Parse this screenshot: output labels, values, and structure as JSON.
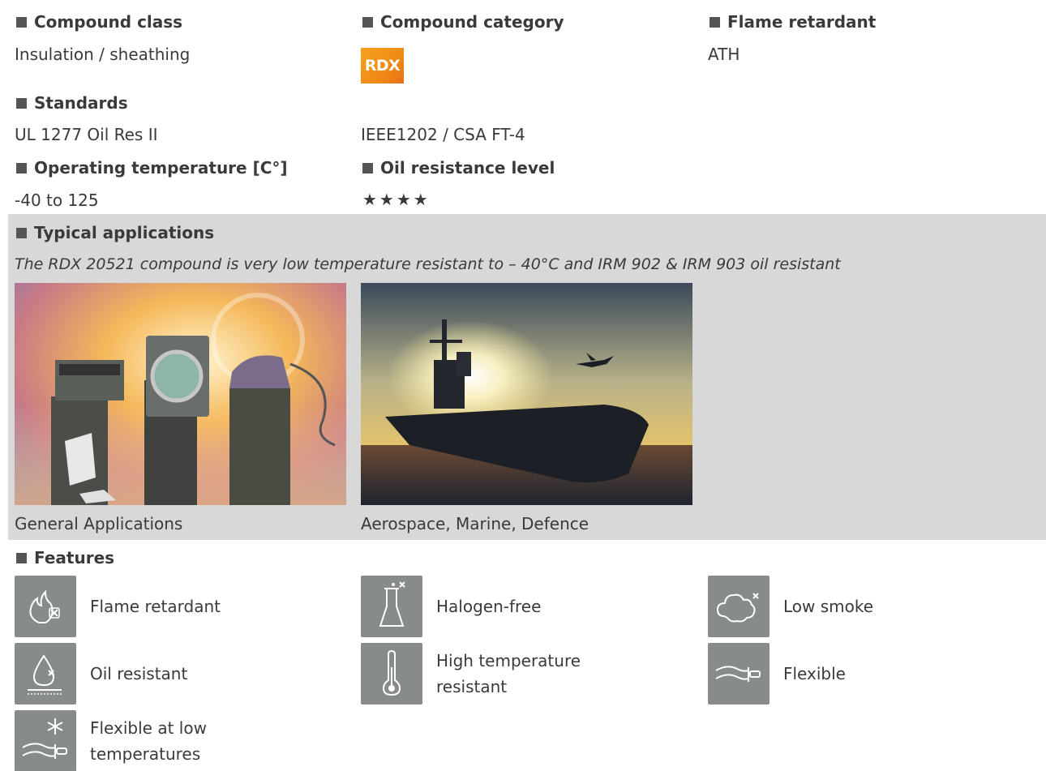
{
  "compound_class": {
    "heading": "Compound class",
    "value": "Insulation / sheathing"
  },
  "compound_category": {
    "heading": "Compound category",
    "logo_text": "RDX"
  },
  "flame_retardant": {
    "heading": "Flame retardant",
    "value": "ATH"
  },
  "standards": {
    "heading": "Standards",
    "items": [
      "UL 1277 Oil Res II",
      "IEEE1202 / CSA FT-4"
    ]
  },
  "operating_temperature": {
    "heading": "Operating temperature [C°]",
    "value": "-40 to 125"
  },
  "oil_resistance": {
    "heading": "Oil resistance level",
    "stars": "★★★★",
    "rating": 4
  },
  "typical_applications": {
    "heading": "Typical applications",
    "description": "The RDX 20521 compound is very low temperature resistant to – 40°C and IRM 902 & IRM 903 oil resistant",
    "images": [
      {
        "caption": "General Applications",
        "icon": "appliances-photo"
      },
      {
        "caption": "Aerospace, Marine, Defence",
        "icon": "warship-photo"
      }
    ]
  },
  "features": {
    "heading": "Features",
    "items": [
      {
        "label": "Flame retardant",
        "icon": "flame-icon"
      },
      {
        "label": "Halogen-free",
        "icon": "flask-icon"
      },
      {
        "label": "Low smoke",
        "icon": "smoke-cloud-icon"
      },
      {
        "label": "Oil resistant",
        "icon": "oil-drop-icon"
      },
      {
        "label": "High temperature resistant",
        "icon": "thermometer-icon"
      },
      {
        "label": "Flexible",
        "icon": "flexible-cable-icon"
      },
      {
        "label": "Flexible at low temperatures",
        "icon": "snowflake-cable-icon"
      }
    ]
  },
  "colors": {
    "band": "#d8d8d8",
    "icon_bg": "#878b8b",
    "logo": "#f08a16",
    "text": "#3a3a3a"
  }
}
